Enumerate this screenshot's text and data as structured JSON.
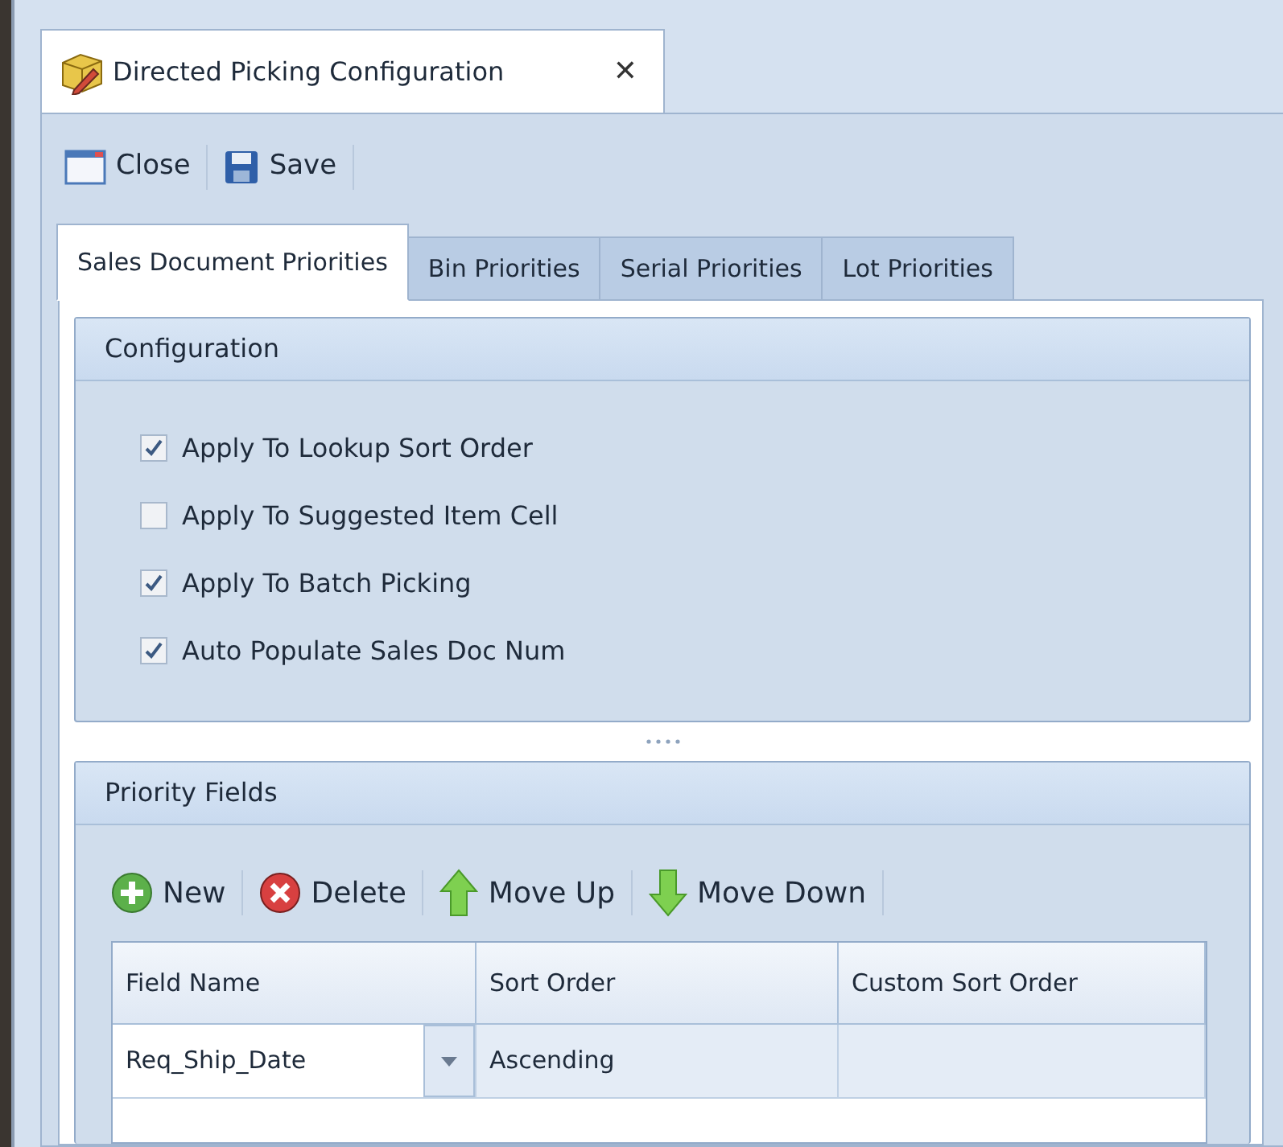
{
  "document_tab": {
    "title": "Directed Picking Configuration",
    "close": "✕"
  },
  "toolbar": [
    "Close",
    "Save"
  ],
  "tabs": [
    {
      "label": "Sales Document Priorities",
      "selected": true
    },
    {
      "label": "Bin Priorities",
      "selected": false
    },
    {
      "label": "Serial Priorities",
      "selected": false
    },
    {
      "label": "Lot Priorities",
      "selected": false
    }
  ],
  "configuration": {
    "title": "Configuration",
    "options": [
      {
        "label": "Apply To Lookup Sort Order",
        "checked": true
      },
      {
        "label": "Apply To Suggested Item Cell",
        "checked": false
      },
      {
        "label": "Apply To Batch Picking",
        "checked": true
      },
      {
        "label": "Auto Populate Sales Doc Num",
        "checked": true
      }
    ]
  },
  "priority_fields": {
    "title": "Priority Fields",
    "toolbar": [
      {
        "kind": "new",
        "label": "New"
      },
      {
        "kind": "delete",
        "label": "Delete"
      },
      {
        "kind": "up",
        "label": "Move Up"
      },
      {
        "kind": "down",
        "label": "Move Down"
      }
    ],
    "table": {
      "columns": [
        "Field Name",
        "Sort Order",
        "Custom Sort Order"
      ],
      "rows": [
        [
          "Req_Ship_Date",
          "Ascending",
          ""
        ]
      ]
    }
  }
}
